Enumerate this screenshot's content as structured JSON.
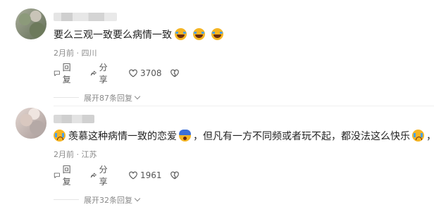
{
  "comments": [
    {
      "text": "要么三观一致要么病情一致",
      "time": "2月前",
      "location": "四川",
      "reply_label": "回复",
      "share_label": "分享",
      "likes": "3708",
      "expand_label": "展开87条回复",
      "emojis": [
        "laugh-cry-emoji",
        "laugh-cry-emoji",
        "laugh-cry-emoji"
      ]
    },
    {
      "text_a": "羡慕这种病情一致的恋爱",
      "text_b": "，但凡有一方不同频或者玩不起，都没法这么快乐",
      "text_c": "，",
      "time": "2月前",
      "location": "江苏",
      "reply_label": "回复",
      "share_label": "分享",
      "likes": "1961",
      "expand_label": "展开32条回复",
      "emojis": [
        "crying-emoji",
        "shocked-emoji",
        "crying-emoji"
      ]
    }
  ],
  "separator": " · ",
  "colors": {
    "text": "#222222",
    "meta": "#8a8a8a",
    "action": "#555555"
  }
}
